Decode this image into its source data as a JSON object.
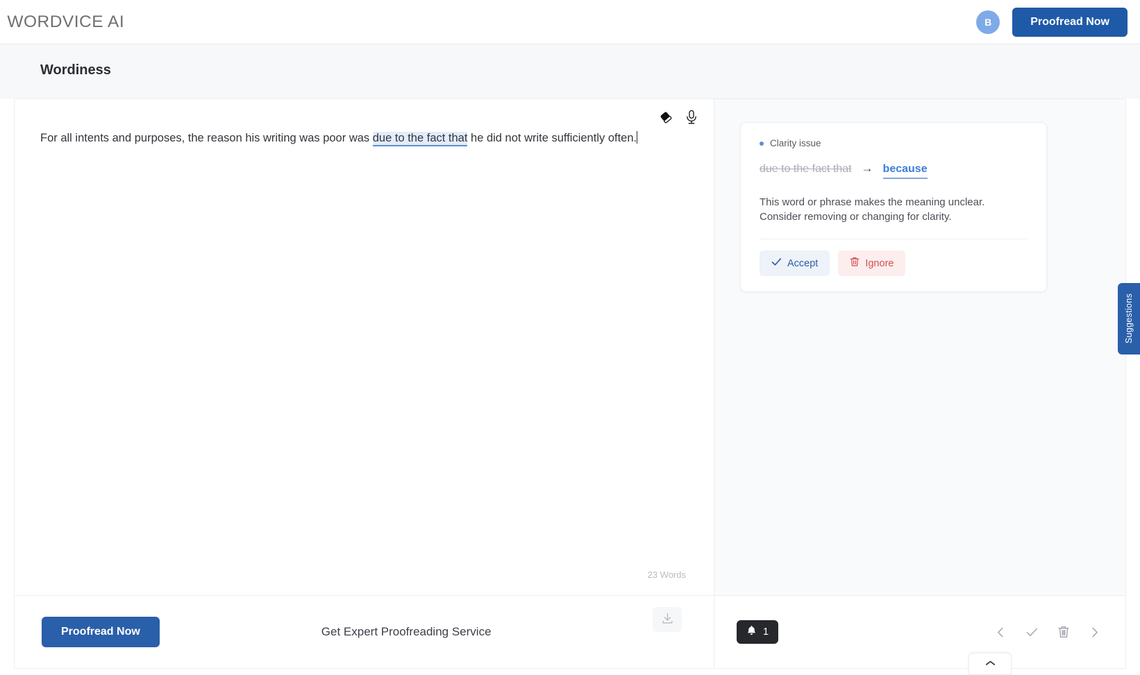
{
  "header": {
    "logo_text": "WORDVICE AI",
    "avatar_initial": "B",
    "proofread_label": "Proofread Now"
  },
  "page": {
    "title": "Wordiness"
  },
  "editor": {
    "text_before": "For all intents and purposes, the reason his writing was poor was ",
    "highlighted_phrase": "due to the fact that",
    "text_after": " he did not write sufficiently often.",
    "word_count": "23 Words",
    "eraser_icon": "eraser-icon",
    "mic_icon": "microphone-icon"
  },
  "suggestion": {
    "issue_type": "Clarity issue",
    "original": "due to the fact that",
    "arrow": "→",
    "replacement": "because",
    "description": "This word or phrase makes the meaning unclear. Consider removing or changing for clarity.",
    "accept_label": "Accept",
    "ignore_label": "Ignore"
  },
  "side_tab": {
    "label": "Suggestions"
  },
  "footer": {
    "proofread_label": "Proofread Now",
    "expert_label": "Get Expert Proofreading Service",
    "download_icon": "download-icon",
    "notification_count": "1",
    "nav_prev": "chevron-left-icon",
    "nav_accept": "check-icon",
    "nav_delete": "trash-icon",
    "nav_next": "chevron-right-icon",
    "popup_toggle": "chevron-up-icon"
  },
  "colors": {
    "brand_blue": "#2a5faa",
    "accent_blue": "#3b7dd8",
    "avatar_blue": "#7faae8",
    "ignore_red": "#d3504f",
    "highlight_bg": "#e2ecfa"
  }
}
